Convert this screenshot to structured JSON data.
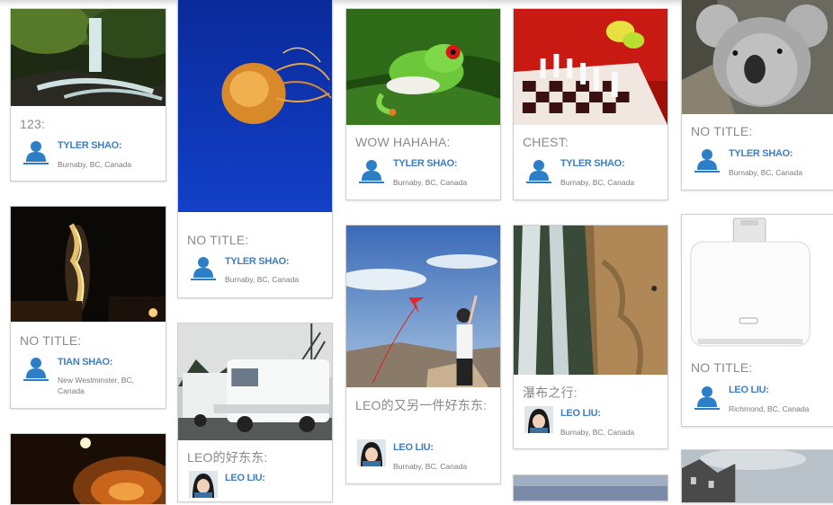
{
  "cards": {
    "waterfall_forest": {
      "title": "123:",
      "user": "TYLER SHAO:",
      "location": "Burnaby, BC, Canada"
    },
    "jellyfish": {
      "title": "NO TITLE:",
      "user": "TYLER SHAO:",
      "location": "Burnaby, BC, Canada"
    },
    "frog": {
      "title": "WOW HAHAHA:",
      "user": "TYLER SHAO:",
      "location": "Burnaby, BC, Canada"
    },
    "chess": {
      "title": "CHEST:",
      "user": "TYLER SHAO:",
      "location": "Burnaby, BC, Canada"
    },
    "koala": {
      "title": "NO TITLE:",
      "user": "TYLER SHAO:",
      "location": "Burnaby, BC, Canada"
    },
    "fire": {
      "title": "NO TITLE:",
      "user": "TIAN SHAO:",
      "location": "New Westminster, BC, Canada"
    },
    "kite": {
      "title": "LEO的又另一件好东东:",
      "user": "LEO LIU:",
      "location": "Burnaby, BC, Canada"
    },
    "cliff": {
      "title": "瀑布之行:",
      "user": "LEO LIU:",
      "location": "Burnaby, BC, Canada"
    },
    "adapter": {
      "title": "NO TITLE:",
      "user": "LEO LIU:",
      "location": "Richmond, BC, Canada"
    },
    "vans": {
      "title": "LEO的好东东:",
      "user": "LEO LIU:",
      "location": ""
    }
  },
  "icons": {
    "default_avatar": "person-silhouette-icon",
    "leo_avatar": "photo-avatar"
  },
  "colors": {
    "username": "#3f7fbf",
    "avatar_blue": "#2c7fc6",
    "title_gray": "#8a8a8a"
  }
}
